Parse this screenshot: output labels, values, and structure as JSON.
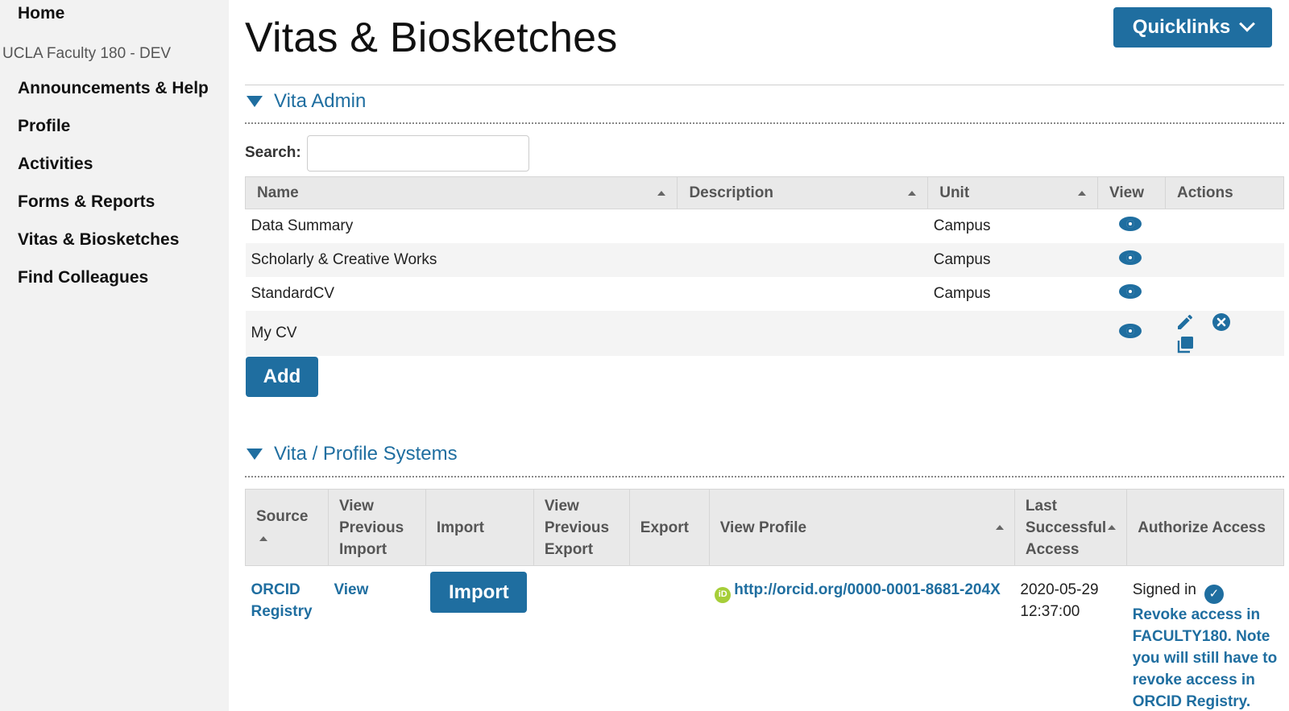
{
  "sidebar": {
    "home": "Home",
    "org": "UCLA Faculty 180 - DEV",
    "items": [
      {
        "label": "Announcements & Help"
      },
      {
        "label": "Profile"
      },
      {
        "label": "Activities"
      },
      {
        "label": "Forms & Reports"
      },
      {
        "label": "Vitas & Biosketches"
      },
      {
        "label": "Find Colleagues"
      }
    ]
  },
  "header": {
    "title": "Vitas & Biosketches",
    "quicklinks": "Quicklinks"
  },
  "vita_admin": {
    "heading": "Vita Admin",
    "search_label": "Search:",
    "search_value": "",
    "columns": [
      "Name",
      "Description",
      "Unit",
      "View",
      "Actions"
    ],
    "rows": [
      {
        "name": "Data Summary",
        "description": "",
        "unit": "Campus"
      },
      {
        "name": "Scholarly & Creative Works",
        "description": "",
        "unit": "Campus"
      },
      {
        "name": "StandardCV",
        "description": "",
        "unit": "Campus"
      },
      {
        "name": "My CV",
        "description": "",
        "unit": ""
      }
    ],
    "add_label": "Add"
  },
  "systems": {
    "heading": "Vita / Profile Systems",
    "columns": {
      "source": "Source",
      "view_prev_import": "View Previous Import",
      "import": "Import",
      "view_prev_export": "View Previous Export",
      "export": "Export",
      "view_profile": "View Profile",
      "last_access": "Last Successful Access",
      "authorize": "Authorize Access"
    },
    "row": {
      "source": "ORCID Registry",
      "view": "View",
      "import_btn": "Import",
      "orcid_badge": "iD",
      "profile_url": "http://orcid.org/0000-0001-8681-204X",
      "last_access": "2020-05-29 12:37:00",
      "signed_in": "Signed in",
      "revoke": "Revoke access in FACULTY180. Note you will still have to revoke access in ORCID Registry."
    }
  },
  "colors": {
    "accent": "#1f6ea0",
    "sidebar_bg": "#f2f2f2",
    "orcid": "#a6ce39"
  },
  "icons": [
    "eye-icon",
    "pencil-icon",
    "delete-circle-icon",
    "copy-icon",
    "chevron-down-icon",
    "check-circle-icon",
    "orcid-icon",
    "sort-up-icon",
    "triangle-down-icon"
  ]
}
